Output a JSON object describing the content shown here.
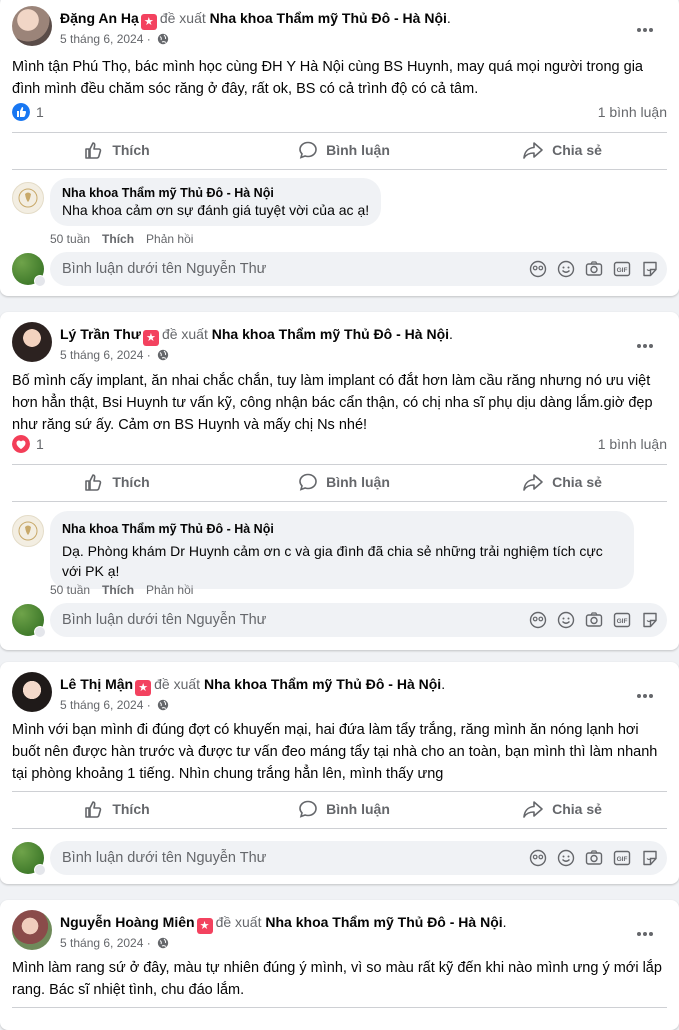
{
  "posts": [
    {
      "author": "Đặng An Hạ",
      "verb": "đề xuất",
      "page": "Nha khoa Thẩm mỹ Thủ Đô - Hà Nội",
      "date": "5 tháng 6, 2024",
      "text": "Mình tận Phú Thọ, bác mình học cùng ĐH Y Hà Nội cùng BS Huynh, may quá mọi người trong gia đình mình đều chăm sóc răng ở đây, rất ok, BS có cả trình độ có cả tâm.",
      "reaction_count": "1",
      "comment_count": "1 bình luận",
      "reply": {
        "name": "Nha khoa Thẩm mỹ Thủ Đô - Hà Nội",
        "text": "Nha khoa cảm ơn sự đánh giá tuyệt vời của ac ạ!",
        "time": "50 tuần",
        "like": "Thích",
        "reply": "Phản hồi"
      }
    },
    {
      "author": "Lý Trần Thư",
      "verb": "đề xuất",
      "page": "Nha khoa Thẩm mỹ Thủ Đô - Hà Nội",
      "date": "5 tháng 6, 2024",
      "text": "Bố mình cấy implant, ăn nhai chắc chắn, tuy làm implant có đắt hơn làm cầu răng nhưng nó ưu việt hơn hẳn thật, Bsi Huynh tư vấn kỹ, công nhận bác cẩn thận, có chị nha sĩ phụ dịu dàng lắm.giờ đẹp như răng sứ ấy. Cảm ơn BS Huynh và mấy chị Ns nhé!",
      "reaction_count": "1",
      "comment_count": "1 bình luận",
      "reply": {
        "name": "Nha khoa Thẩm mỹ Thủ Đô - Hà Nội",
        "text": "Dạ. Phòng khám Dr Huynh cảm ơn c và gia đình đã chia sẻ những trải nghiệm tích cực với PK ạ!",
        "time": "50 tuần",
        "like": "Thích",
        "reply": "Phản hồi"
      }
    },
    {
      "author": "Lê Thị Mận",
      "verb": "đề xuất",
      "page": "Nha khoa Thẩm mỹ Thủ Đô - Hà Nội",
      "date": "5 tháng 6, 2024",
      "text": "Mình với bạn mình đi đúng đợt có khuyến mại, hai đứa làm tẩy trắng, răng mình ăn nóng lạnh hơi buốt nên được hàn trước và được tư vấn đeo máng tẩy tại nhà cho an toàn, bạn mình thì làm nhanh tại phòng khoảng 1 tiếng. Nhìn chung trắng hẳn lên, mình thấy ưng"
    },
    {
      "author": "Nguyễn Hoàng Miên",
      "verb": "đề xuất",
      "page": "Nha khoa Thẩm mỹ Thủ Đô - Hà Nội",
      "date": "5 tháng 6, 2024",
      "text": "Mình làm rang sứ ở đây, màu tự nhiên đúng ý mình, vì so màu rất kỹ đến khi nào mình ưng ý mới lắp rang. Bác sĩ nhiệt tình, chu đáo lắm."
    }
  ],
  "actions": {
    "like": "Thích",
    "comment": "Bình luận",
    "share": "Chia sẻ"
  },
  "write_placeholder": "Bình luận dưới tên Nguyễn Thư",
  "icons": {
    "badge": "recommend-star-icon",
    "privacy": "globe-icon",
    "more": "more-dots-icon",
    "like": "thumbs-up-icon",
    "comment": "comment-bubble-icon",
    "share": "share-arrow-icon",
    "tools": [
      "avatar-sticker-icon",
      "emoji-icon",
      "camera-icon",
      "gif-icon",
      "sticker-icon"
    ]
  },
  "colors": {
    "like_blue": "#1877f2",
    "love_red": "#f33e58",
    "badge_red": "#f3425f",
    "muted": "#65676b"
  }
}
